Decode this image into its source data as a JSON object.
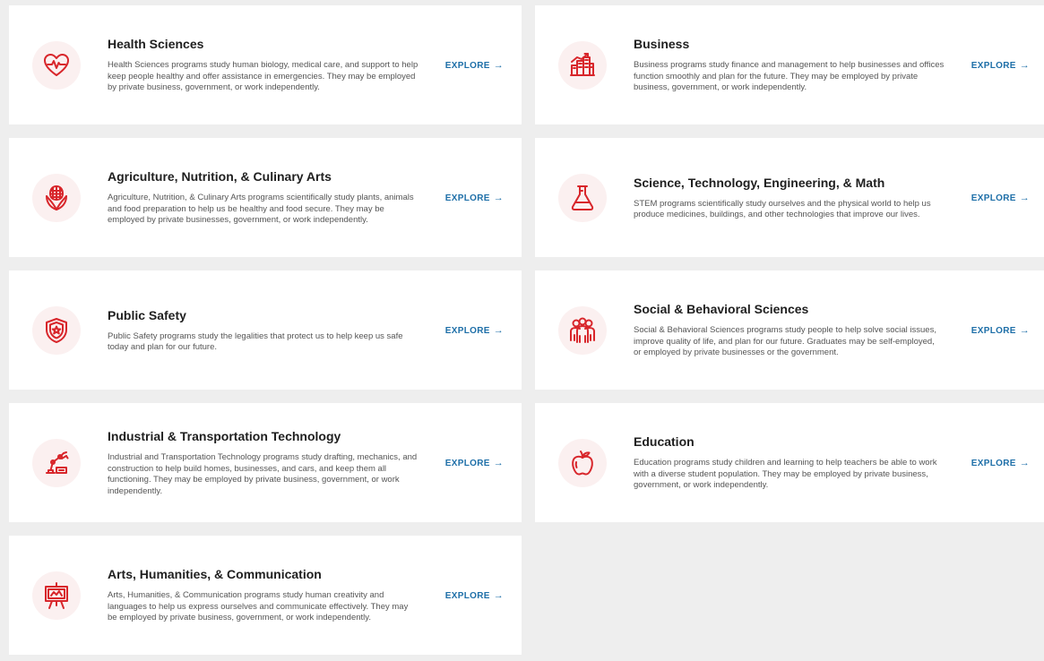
{
  "colors": {
    "accent": "#d8262b",
    "link": "#1e6fa8",
    "icon_bg": "#fbf0f0",
    "page_bg": "#eeeeee"
  },
  "explore_label": "EXPLORE",
  "explore_arrow": "→",
  "programs": [
    {
      "icon": "heart-pulse-icon",
      "title": "Health Sciences",
      "description": "Health Sciences programs study human biology, medical care, and support to help keep people healthy and offer assistance in emergencies. They may be employed by private business, government, or work independently."
    },
    {
      "icon": "business-buildings-icon",
      "title": "Business",
      "description": "Business programs study finance and management to help businesses and offices function smoothly and plan for the future. They may be employed by private business, government, or work independently."
    },
    {
      "icon": "corn-icon",
      "title": "Agriculture, Nutrition, & Culinary Arts",
      "description": "Agriculture, Nutrition, & Culinary Arts programs scientifically study plants, animals and food preparation to help us be healthy and food secure. They may be employed by private businesses, government, or work independently."
    },
    {
      "icon": "flask-icon",
      "title": "Science, Technology, Engineering, & Math",
      "description": "STEM programs scientifically study ourselves and the physical world to help us produce medicines, buildings, and other technologies that improve our lives."
    },
    {
      "icon": "badge-shield-icon",
      "title": "Public Safety",
      "description": "Public Safety programs study the legalities that protect us to help keep us safe today and plan for our future."
    },
    {
      "icon": "people-group-icon",
      "title": "Social & Behavioral Sciences",
      "description": "Social & Behavioral Sciences programs study people to help solve social issues, improve quality of life, and plan for our future. Graduates may be self-employed, or employed by private businesses or the government."
    },
    {
      "icon": "robotic-arm-icon",
      "title": "Industrial & Transportation Technology",
      "description": "Industrial and Transportation Technology programs study drafting, mechanics, and construction to help build homes, businesses, and cars, and keep them all functioning. They may be employed by private business, government, or work independently."
    },
    {
      "icon": "apple-icon",
      "title": "Education",
      "description": "Education programs study children and learning to help teachers be able to work with a diverse student population. They may be employed by private business, government, or work independently."
    },
    {
      "icon": "easel-icon",
      "title": "Arts, Humanities, & Communication",
      "description": "Arts, Humanities, & Communication programs study human creativity and languages to help us express ourselves and communicate effectively. They may be employed by private business, government, or work independently."
    }
  ]
}
